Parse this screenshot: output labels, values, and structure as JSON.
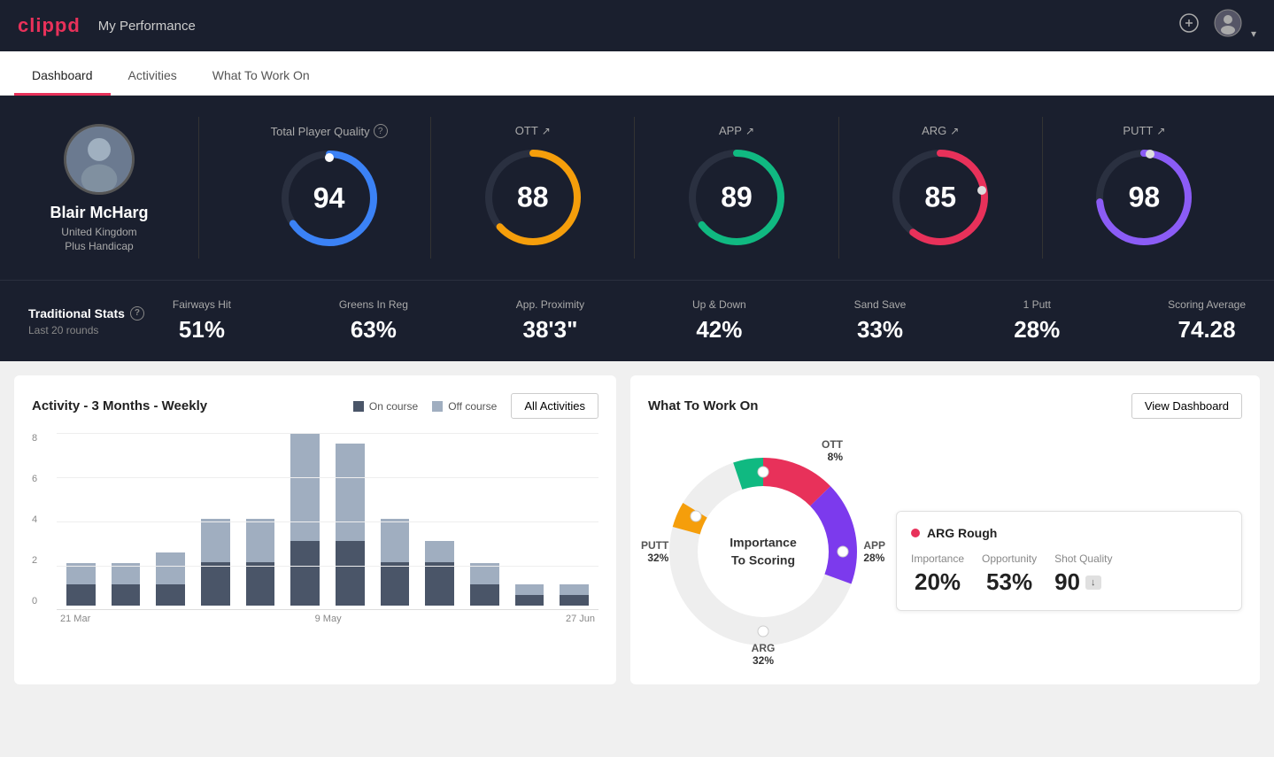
{
  "header": {
    "logo": "clippd",
    "title": "My Performance",
    "add_icon": "⊕",
    "user_avatar": "👤"
  },
  "nav": {
    "tabs": [
      {
        "id": "dashboard",
        "label": "Dashboard",
        "active": true
      },
      {
        "id": "activities",
        "label": "Activities",
        "active": false
      },
      {
        "id": "what-to-work-on",
        "label": "What To Work On",
        "active": false
      }
    ]
  },
  "player": {
    "name": "Blair McHarg",
    "country": "United Kingdom",
    "handicap": "Plus Handicap"
  },
  "quality_label": "Total Player Quality",
  "metrics": {
    "total": {
      "value": "94",
      "color": "#3b82f6",
      "pct": 94
    },
    "ott": {
      "label": "OTT",
      "value": "88",
      "color": "#f59e0b",
      "pct": 88
    },
    "app": {
      "label": "APP",
      "value": "89",
      "color": "#10b981",
      "pct": 89
    },
    "arg": {
      "label": "ARG",
      "value": "85",
      "color": "#e8315a",
      "pct": 85
    },
    "putt": {
      "label": "PUTT",
      "value": "98",
      "color": "#8b5cf6",
      "pct": 98
    }
  },
  "trad_stats": {
    "title": "Traditional Stats",
    "subtitle": "Last 20 rounds",
    "stats": [
      {
        "label": "Fairways Hit",
        "value": "51%"
      },
      {
        "label": "Greens In Reg",
        "value": "63%"
      },
      {
        "label": "App. Proximity",
        "value": "38'3\""
      },
      {
        "label": "Up & Down",
        "value": "42%"
      },
      {
        "label": "Sand Save",
        "value": "33%"
      },
      {
        "label": "1 Putt",
        "value": "28%"
      },
      {
        "label": "Scoring Average",
        "value": "74.28"
      }
    ]
  },
  "activity_chart": {
    "title": "Activity - 3 Months - Weekly",
    "legend": {
      "on_course": "On course",
      "off_course": "Off course"
    },
    "btn_label": "All Activities",
    "y_labels": [
      "8",
      "6",
      "4",
      "2",
      "0"
    ],
    "x_labels": [
      "21 Mar",
      "9 May",
      "27 Jun"
    ],
    "bars": [
      {
        "on": 1,
        "off": 1
      },
      {
        "on": 1,
        "off": 1
      },
      {
        "on": 1,
        "off": 1.5
      },
      {
        "on": 2,
        "off": 2
      },
      {
        "on": 2,
        "off": 2
      },
      {
        "on": 3,
        "off": 5
      },
      {
        "on": 3,
        "off": 4.5
      },
      {
        "on": 2,
        "off": 2
      },
      {
        "on": 2,
        "off": 1
      },
      {
        "on": 1,
        "off": 1
      },
      {
        "on": 0.5,
        "off": 0.5
      },
      {
        "on": 0.5,
        "off": 0.5
      }
    ]
  },
  "what_to_work_on": {
    "title": "What To Work On",
    "btn_label": "View Dashboard",
    "donut_center": "Importance\nTo Scoring",
    "segments": [
      {
        "label": "OTT",
        "pct": "8%",
        "color": "#f59e0b",
        "deg_start": 0,
        "deg_end": 29
      },
      {
        "label": "APP",
        "pct": "28%",
        "color": "#10b981",
        "deg_start": 29,
        "deg_end": 130
      },
      {
        "label": "ARG",
        "pct": "32%",
        "color": "#e8315a",
        "deg_start": 130,
        "deg_end": 245
      },
      {
        "label": "PUTT",
        "pct": "32%",
        "color": "#8b5cf6",
        "deg_start": 245,
        "deg_end": 360
      }
    ],
    "card": {
      "title": "ARG Rough",
      "importance": {
        "label": "Importance",
        "value": "20%"
      },
      "opportunity": {
        "label": "Opportunity",
        "value": "53%"
      },
      "shot_quality": {
        "label": "Shot Quality",
        "value": "90",
        "badge": "↓"
      }
    }
  }
}
